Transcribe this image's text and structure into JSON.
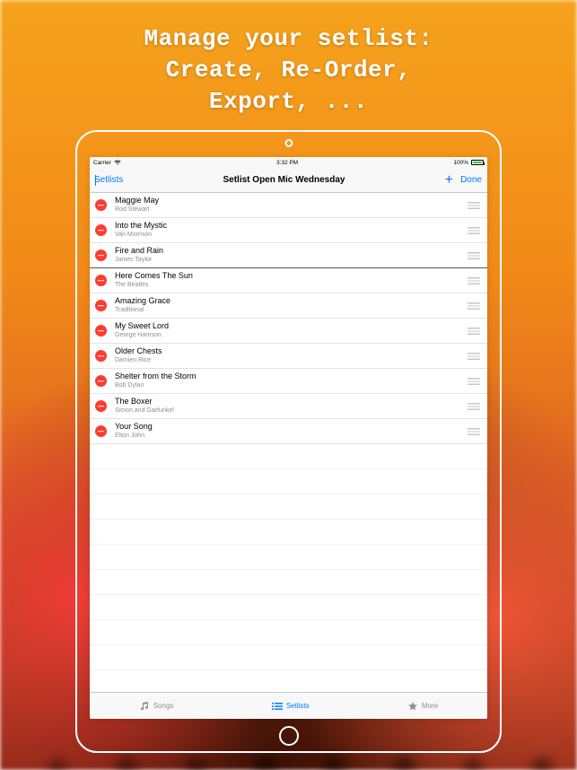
{
  "headline": "Manage your setlist:\nCreate, Re-Order,\nExport, ...",
  "statusbar": {
    "carrier": "Carrier",
    "time": "3:32 PM",
    "battery_text": "100%"
  },
  "navbar": {
    "back_label": "Setlists",
    "title": "Setlist Open Mic Wednesday",
    "done_label": "Done"
  },
  "songs": [
    {
      "title": "Maggie May",
      "artist": "Rod Stewart"
    },
    {
      "title": "Into the Mystic",
      "artist": "Van Morrison"
    },
    {
      "title": "Fire and Rain",
      "artist": "James Taylor"
    },
    {
      "title": "Here Comes The Sun",
      "artist": "The Beatles"
    },
    {
      "title": "Amazing Grace",
      "artist": "Traditional"
    },
    {
      "title": "My Sweet Lord",
      "artist": "George Harrison"
    },
    {
      "title": "Older Chests",
      "artist": "Damien Rice"
    },
    {
      "title": "Shelter from the Storm",
      "artist": "Bob Dylan"
    },
    {
      "title": "The Boxer",
      "artist": "Simon and Garfunkel"
    },
    {
      "title": "Your Song",
      "artist": "Elton John"
    }
  ],
  "strong_separator_after_index": 2,
  "tabs": {
    "songs": "Songs",
    "setlists": "Setlists",
    "more": "More"
  },
  "colors": {
    "tint": "#007aff",
    "delete": "#ff3b30",
    "battery": "#35c759"
  }
}
